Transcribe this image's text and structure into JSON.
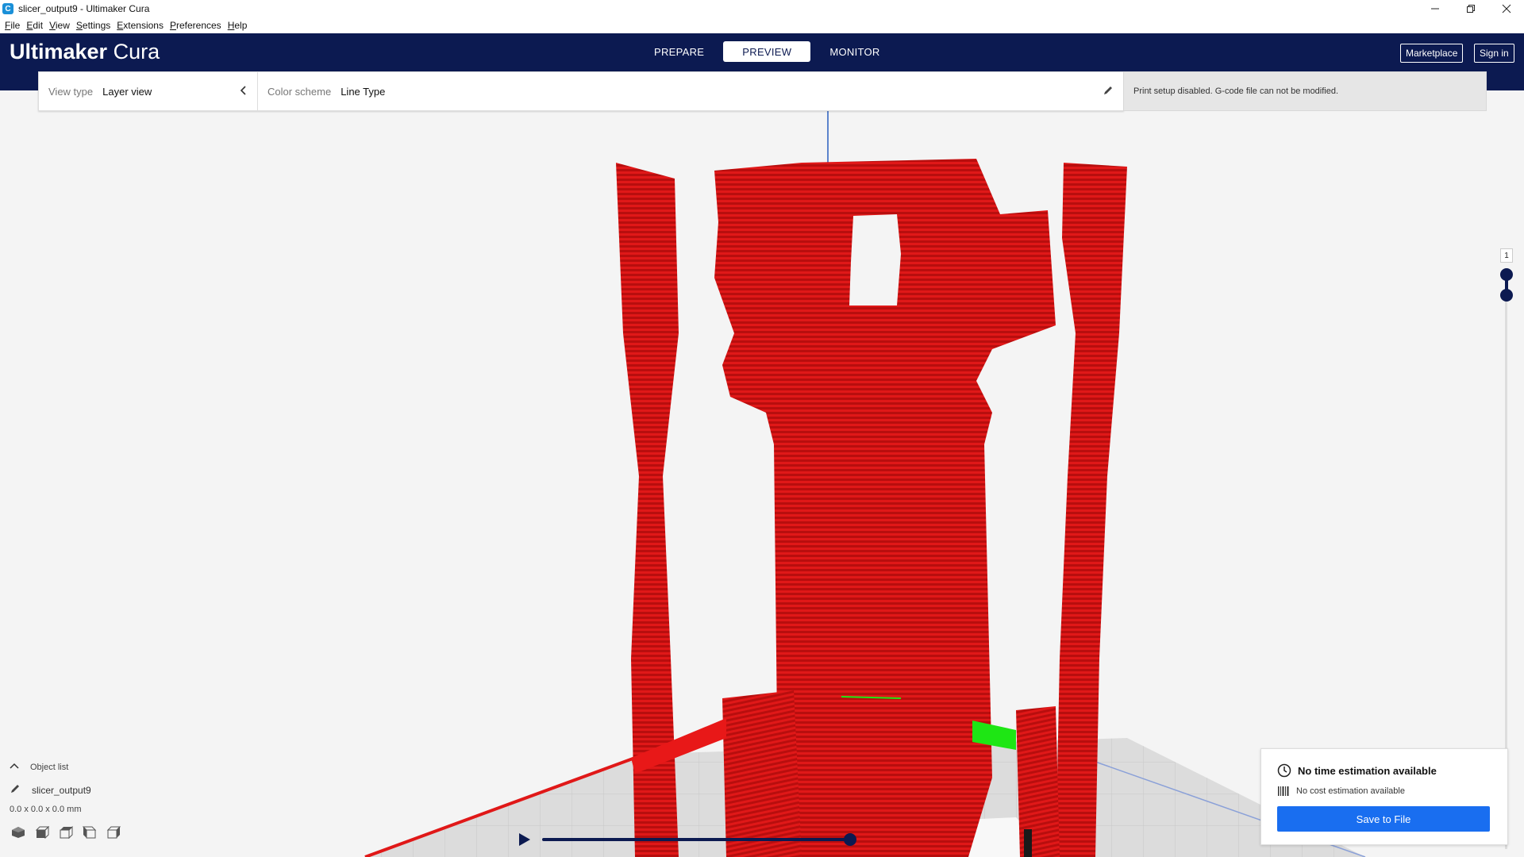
{
  "window": {
    "title": "slicer_output9 - Ultimaker Cura",
    "app_icon_letter": "C"
  },
  "menu": [
    "File",
    "Edit",
    "View",
    "Settings",
    "Extensions",
    "Preferences",
    "Help"
  ],
  "header": {
    "brand_bold": "Ultimaker",
    "brand_light": " Cura",
    "tabs": [
      {
        "label": "PREPARE",
        "active": false
      },
      {
        "label": "PREVIEW",
        "active": true
      },
      {
        "label": "MONITOR",
        "active": false
      }
    ],
    "marketplace_label": "Marketplace",
    "signin_label": "Sign in"
  },
  "toolbar": {
    "view_type_label": "View type",
    "view_type_value": "Layer view",
    "color_scheme_label": "Color scheme",
    "color_scheme_value": "Line Type"
  },
  "setup_message": "Print setup disabled. G-code file can not be modified.",
  "layer_slider": {
    "current_layer": "1"
  },
  "object_list": {
    "toggle_label": "Object list",
    "object_name": "slicer_output9",
    "dimensions": "0.0 x 0.0 x 0.0 mm"
  },
  "action_panel": {
    "time_estimate": "No time estimation available",
    "cost_estimate": "No cost estimation available",
    "save_label": "Save to File"
  },
  "colors": {
    "header_bg": "#0c1a51",
    "model_red": "#d21414",
    "model_green": "#1ee614",
    "accent_blue": "#196ef0"
  },
  "icons": [
    "cura-app-icon",
    "minimize-icon",
    "maximize-icon",
    "close-icon",
    "chevron-left-icon",
    "pencil-icon",
    "clock-icon",
    "barcode-icon",
    "chevron-up-icon",
    "play-icon",
    "3d-view-icon",
    "front-view-icon",
    "top-view-icon",
    "left-view-icon",
    "right-view-icon"
  ]
}
